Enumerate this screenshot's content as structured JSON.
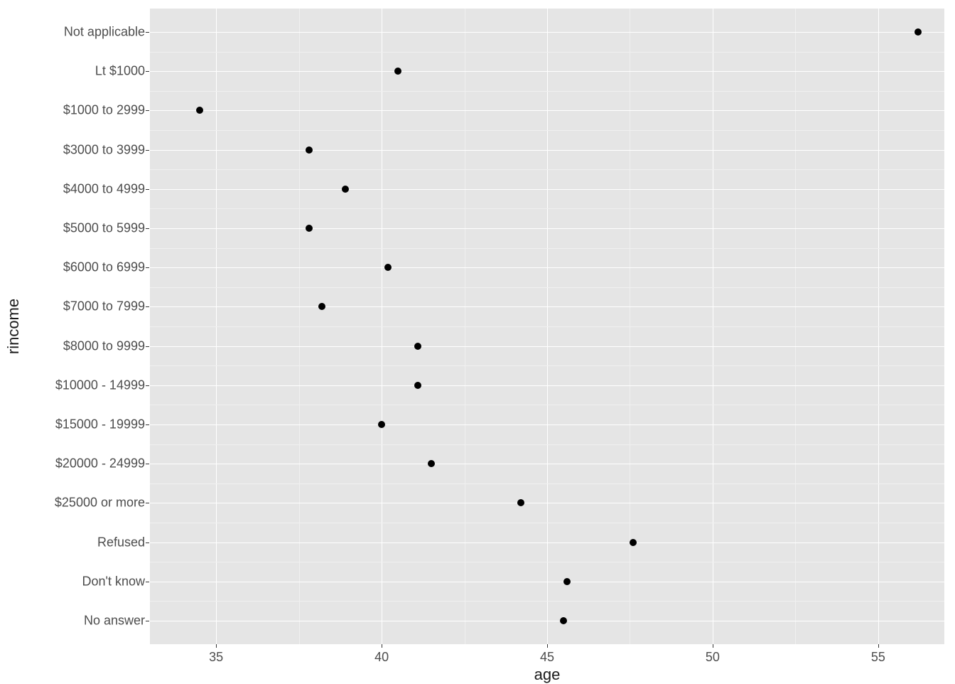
{
  "chart_data": {
    "type": "scatter",
    "xlabel": "age",
    "ylabel": "rincome",
    "xlim": [
      33,
      57
    ],
    "x_major_ticks": [
      35,
      40,
      45,
      50,
      55
    ],
    "x_minor_ticks": [
      37.5,
      42.5,
      47.5,
      52.5
    ],
    "categories_top_to_bottom": [
      "Not applicable",
      "Lt $1000",
      "$1000 to 2999",
      "$3000 to 3999",
      "$4000 to 4999",
      "$5000 to 5999",
      "$6000 to 6999",
      "$7000 to 7999",
      "$8000 to 9999",
      "$10000 - 14999",
      "$15000 - 19999",
      "$20000 - 24999",
      "$25000 or more",
      "Refused",
      "Don't know",
      "No answer"
    ],
    "points": [
      {
        "category": "Not applicable",
        "x": 56.2
      },
      {
        "category": "Lt $1000",
        "x": 40.5
      },
      {
        "category": "$1000 to 2999",
        "x": 34.5
      },
      {
        "category": "$3000 to 3999",
        "x": 37.8
      },
      {
        "category": "$4000 to 4999",
        "x": 38.9
      },
      {
        "category": "$5000 to 5999",
        "x": 37.8
      },
      {
        "category": "$6000 to 6999",
        "x": 40.2
      },
      {
        "category": "$7000 to 7999",
        "x": 38.2
      },
      {
        "category": "$8000 to 9999",
        "x": 41.1
      },
      {
        "category": "$10000 - 14999",
        "x": 41.1
      },
      {
        "category": "$15000 - 19999",
        "x": 40.0
      },
      {
        "category": "$20000 - 24999",
        "x": 41.5
      },
      {
        "category": "$25000 or more",
        "x": 44.2
      },
      {
        "category": "Refused",
        "x": 47.6
      },
      {
        "category": "Don't know",
        "x": 45.6
      },
      {
        "category": "No answer",
        "x": 45.5
      }
    ]
  }
}
